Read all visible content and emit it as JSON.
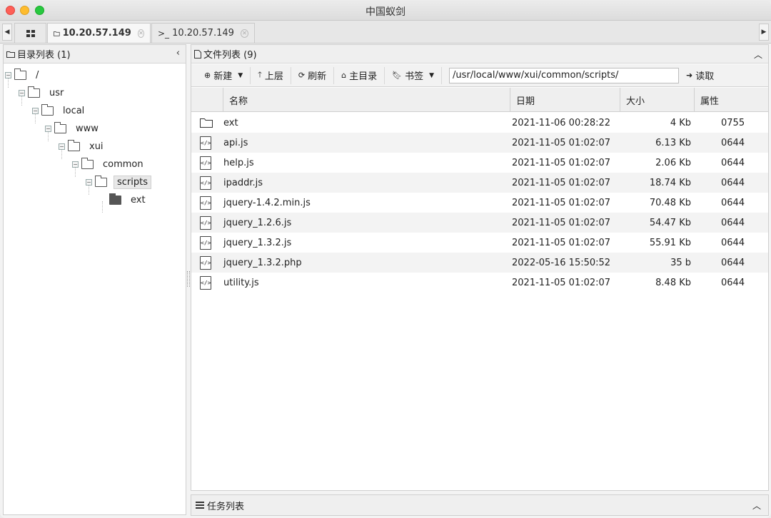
{
  "window": {
    "title": "中国蚁剑"
  },
  "tabs": [
    {
      "label": "10.20.57.149",
      "icon": "folder-icon",
      "active": true
    },
    {
      "label": "10.20.57.149",
      "icon": "terminal-icon",
      "active": false
    }
  ],
  "left_panel": {
    "title": "目录列表 (1)",
    "tree": [
      {
        "label": "/",
        "depth": 0
      },
      {
        "label": "usr",
        "depth": 1
      },
      {
        "label": "local",
        "depth": 2
      },
      {
        "label": "www",
        "depth": 3
      },
      {
        "label": "xui",
        "depth": 4
      },
      {
        "label": "common",
        "depth": 5
      },
      {
        "label": "scripts",
        "depth": 6,
        "selected": true
      },
      {
        "label": "ext",
        "depth": 7,
        "filled": true
      }
    ]
  },
  "right_panel": {
    "title": "文件列表 (9)",
    "toolbar": {
      "new_label": "新建",
      "up_label": "上层",
      "refresh_label": "刷新",
      "home_label": "主目录",
      "bookmark_label": "书签",
      "path_value": "/usr/local/www/xui/common/scripts/",
      "read_label": "读取"
    },
    "columns": {
      "name": "名称",
      "date": "日期",
      "size": "大小",
      "perm": "属性"
    },
    "files": [
      {
        "name": "ext",
        "date": "2021-11-06 00:28:22",
        "size": "4 Kb",
        "perm": "0755",
        "type": "folder"
      },
      {
        "name": "api.js",
        "date": "2021-11-05 01:02:07",
        "size": "6.13 Kb",
        "perm": "0644",
        "type": "code"
      },
      {
        "name": "help.js",
        "date": "2021-11-05 01:02:07",
        "size": "2.06 Kb",
        "perm": "0644",
        "type": "code"
      },
      {
        "name": "ipaddr.js",
        "date": "2021-11-05 01:02:07",
        "size": "18.74 Kb",
        "perm": "0644",
        "type": "code"
      },
      {
        "name": "jquery-1.4.2.min.js",
        "date": "2021-11-05 01:02:07",
        "size": "70.48 Kb",
        "perm": "0644",
        "type": "code"
      },
      {
        "name": "jquery_1.2.6.js",
        "date": "2021-11-05 01:02:07",
        "size": "54.47 Kb",
        "perm": "0644",
        "type": "code"
      },
      {
        "name": "jquery_1.3.2.js",
        "date": "2021-11-05 01:02:07",
        "size": "55.91 Kb",
        "perm": "0644",
        "type": "code"
      },
      {
        "name": "jquery_1.3.2.php",
        "date": "2022-05-16 15:50:52",
        "size": "35 b",
        "perm": "0644",
        "type": "code"
      },
      {
        "name": "utility.js",
        "date": "2021-11-05 01:02:07",
        "size": "8.48 Kb",
        "perm": "0644",
        "type": "code"
      }
    ]
  },
  "task_bar": {
    "title": "任务列表"
  }
}
